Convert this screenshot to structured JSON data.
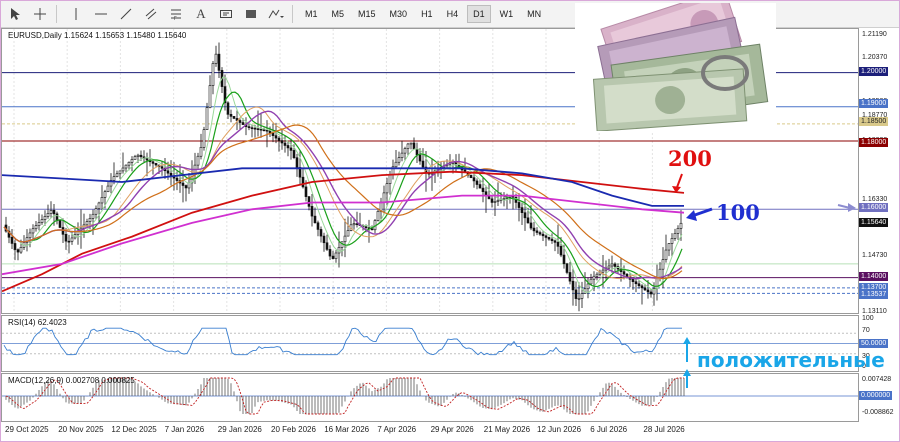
{
  "toolbar": {
    "timeframes": [
      "M1",
      "M5",
      "M15",
      "M30",
      "H1",
      "H4",
      "D1",
      "W1",
      "MN"
    ],
    "active_timeframe": "D1"
  },
  "chart": {
    "symbol_line": "EURUSD,Daily  1.15624 1.15653 1.15480 1.15640",
    "rsi_line": "RSI(14) 62.4023",
    "macd_line": "MACD(12,26,9) 0.002708 0.000825",
    "annotation_200": "200",
    "annotation_100": "100",
    "annotation_positive": "положительные"
  },
  "price_scale": {
    "ticks": [
      "1.21190",
      "1.20370",
      "1.19500",
      "1.18770",
      "1.18000",
      "1.16330",
      "1.15640",
      "1.14730",
      "1.13110"
    ],
    "tags": [
      {
        "label": "1.20000",
        "color": "#1c1f7a"
      },
      {
        "label": "1.19000",
        "color": "#4a73c8"
      },
      {
        "label": "1.18500",
        "color": "#d9c98a"
      },
      {
        "label": "1.18000",
        "color": "#8b0000"
      },
      {
        "label": "1.16000",
        "color": "#7070c0"
      },
      {
        "label": "1.15640",
        "color": "#111111"
      },
      {
        "label": "1.14000",
        "color": "#5a1060"
      },
      {
        "label": "1.13700",
        "color": "#4a73c8"
      },
      {
        "label": "1.13537",
        "color": "#4a73c8"
      }
    ]
  },
  "rsi_scale": {
    "ticks": [
      "100",
      "70",
      "30",
      "0"
    ],
    "tag": "50.0000"
  },
  "macd_scale": {
    "ticks": [
      "0.007428",
      "-0.008862"
    ],
    "tag": "0.000000"
  },
  "dates": [
    "29 Oct 2025",
    "20 Nov 2025",
    "12 Dec 2025",
    "7 Jan 2026",
    "29 Jan 2026",
    "20 Feb 2026",
    "16 Mar 2026",
    "7 Apr 2026",
    "29 Apr 2026",
    "21 May 2026",
    "12 Jun 2026",
    "6 Jul 2026",
    "28 Jul 2026"
  ],
  "colors": {
    "ma200": "#d01010",
    "ma100": "#1a2ab0",
    "ma_magenta": "#d030d0",
    "ma_orange": "#d0701a",
    "ma_green": "#1aa01a",
    "ma_violet": "#9040b0",
    "candles": "#111111",
    "rsi_line": "#3a7fd0",
    "macd_signal": "#c02020"
  }
}
